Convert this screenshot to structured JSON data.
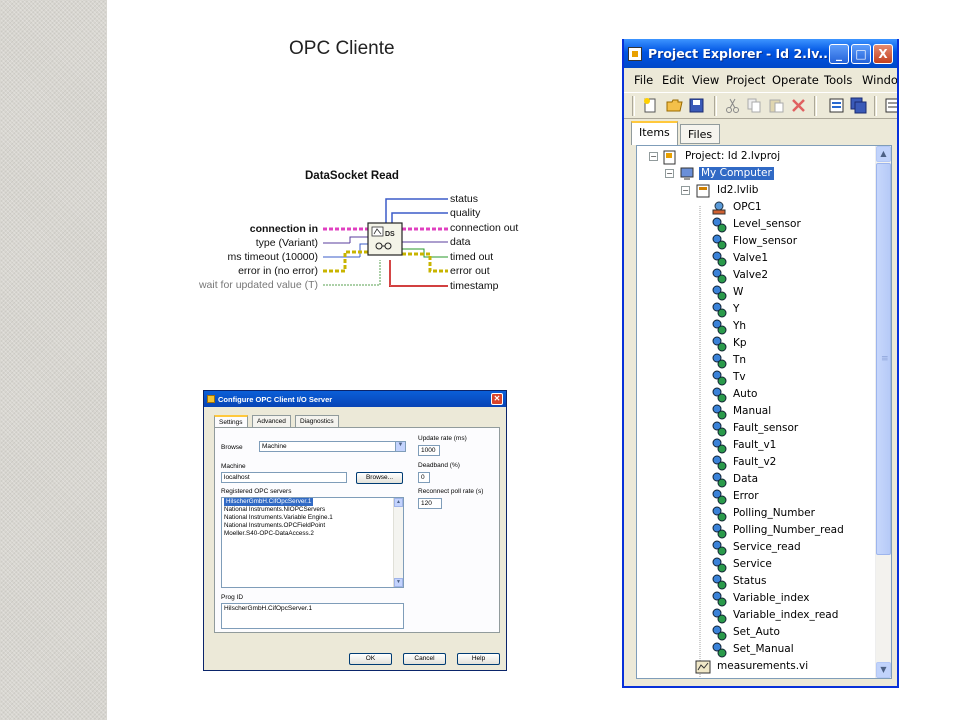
{
  "slide": {
    "title": "OPC Cliente"
  },
  "datasocket": {
    "title": "DataSocket Read",
    "inputs": [
      {
        "label": "connection in",
        "style": "bold"
      },
      {
        "label": "type (Variant)",
        "style": "normal"
      },
      {
        "label": "ms timeout (10000)",
        "style": "normal"
      },
      {
        "label": "error in (no error)",
        "style": "normal"
      },
      {
        "label": "wait for updated value (T)",
        "style": "gray"
      }
    ],
    "outputs": [
      "status",
      "quality",
      "connection out",
      "data",
      "timed out",
      "error out",
      "timestamp"
    ],
    "icon_label": "DS"
  },
  "config_dialog": {
    "title": "Configure OPC Client I/O Server",
    "close": "✕",
    "tabs": [
      "Settings",
      "Advanced",
      "Diagnostics"
    ],
    "browse_label": "Browse",
    "browse_value": "Machine",
    "machine_label": "Machine",
    "machine_value": "localhost",
    "browse_button": "Browse...",
    "registered_label": "Registered OPC servers",
    "servers": [
      "HilscherGmbH.CifOpcServer.1",
      "National Instruments.NIOPCServers",
      "National Instruments.Variable Engine.1",
      "National Instruments.OPCFieldPoint",
      "Moeller.S40-OPC-DataAccess.2"
    ],
    "selected_server_index": 0,
    "progid_label": "Prog ID",
    "progid_value": "HilscherGmbH.CifOpcServer.1",
    "update_rate_label": "Update rate (ms)",
    "update_rate_value": "1000",
    "deadband_label": "Deadband (%)",
    "deadband_value": "0",
    "reconnect_label": "Reconnect poll rate (s)",
    "reconnect_value": "120",
    "ok": "OK",
    "cancel": "Cancel",
    "help": "Help"
  },
  "project_explorer": {
    "title": "Project Explorer - Id 2.lv...",
    "minimize": "_",
    "maximize": "□",
    "close": "X",
    "menus": [
      "File",
      "Edit",
      "View",
      "Project",
      "Operate",
      "Tools",
      "Window"
    ],
    "tabs": [
      "Items",
      "Files"
    ],
    "project": "Project: Id 2.lvproj",
    "computer": "My Computer",
    "library": "Id2.lvlib",
    "server": "OPC1",
    "variables": [
      "Level_sensor",
      "Flow_sensor",
      "Valve1",
      "Valve2",
      "W",
      "Y",
      "Yh",
      "Kp",
      "Tn",
      "Tv",
      "Auto",
      "Manual",
      "Fault_sensor",
      "Fault_v1",
      "Fault_v2",
      "Data",
      "Error",
      "Polling_Number",
      "Polling_Number_read",
      "Service_read",
      "Service",
      "Status",
      "Variable_index",
      "Variable_index_read",
      "Set_Auto",
      "Set_Manual"
    ],
    "vi": "measurements.vi",
    "colors": {
      "titlebar": "#0054e3",
      "selection": "#316ac5",
      "window_bg": "#ece9d8"
    }
  }
}
